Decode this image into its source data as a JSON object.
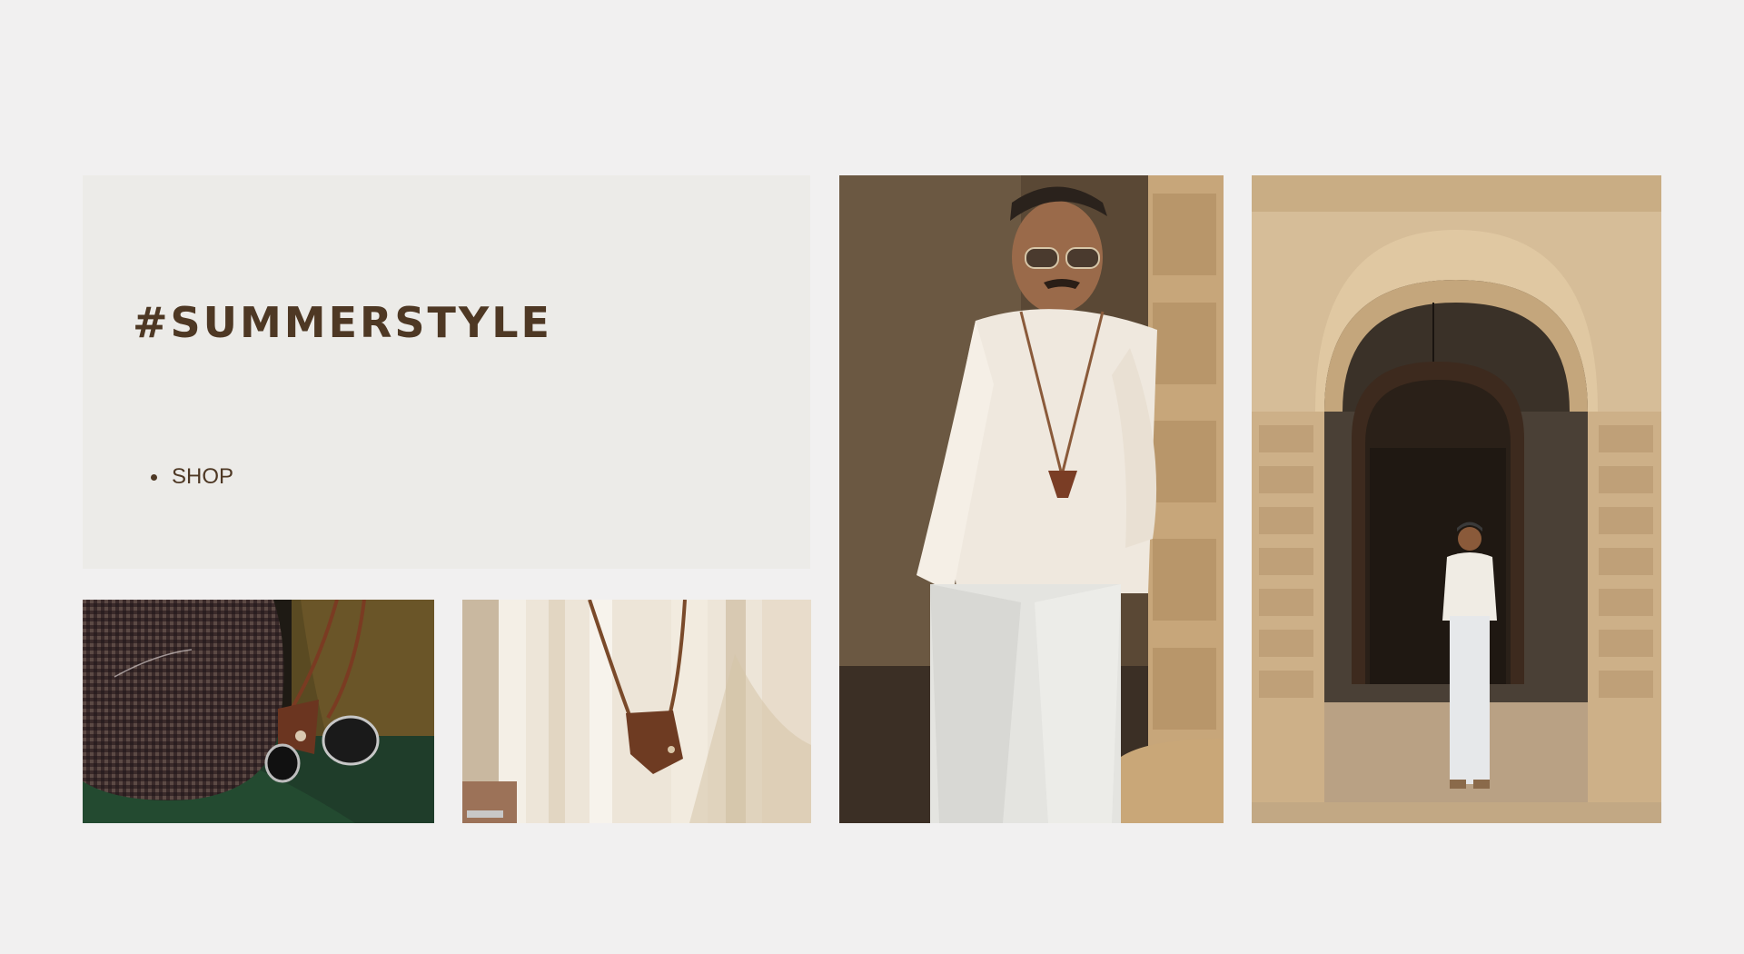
{
  "hero": {
    "title": "#SUMMERSTYLE",
    "links": [
      {
        "label": "SHOP"
      }
    ]
  },
  "photos": [
    {
      "id": "accessories",
      "alt_icon": "image-icon"
    },
    {
      "id": "necklace",
      "alt_icon": "image-icon"
    },
    {
      "id": "portrait",
      "alt_icon": "image-icon"
    },
    {
      "id": "archway",
      "alt_icon": "image-icon"
    }
  ],
  "colors": {
    "page_background": "#f1f0f0",
    "panel_background": "#ecebe8",
    "brand_text": "#4e3824"
  }
}
